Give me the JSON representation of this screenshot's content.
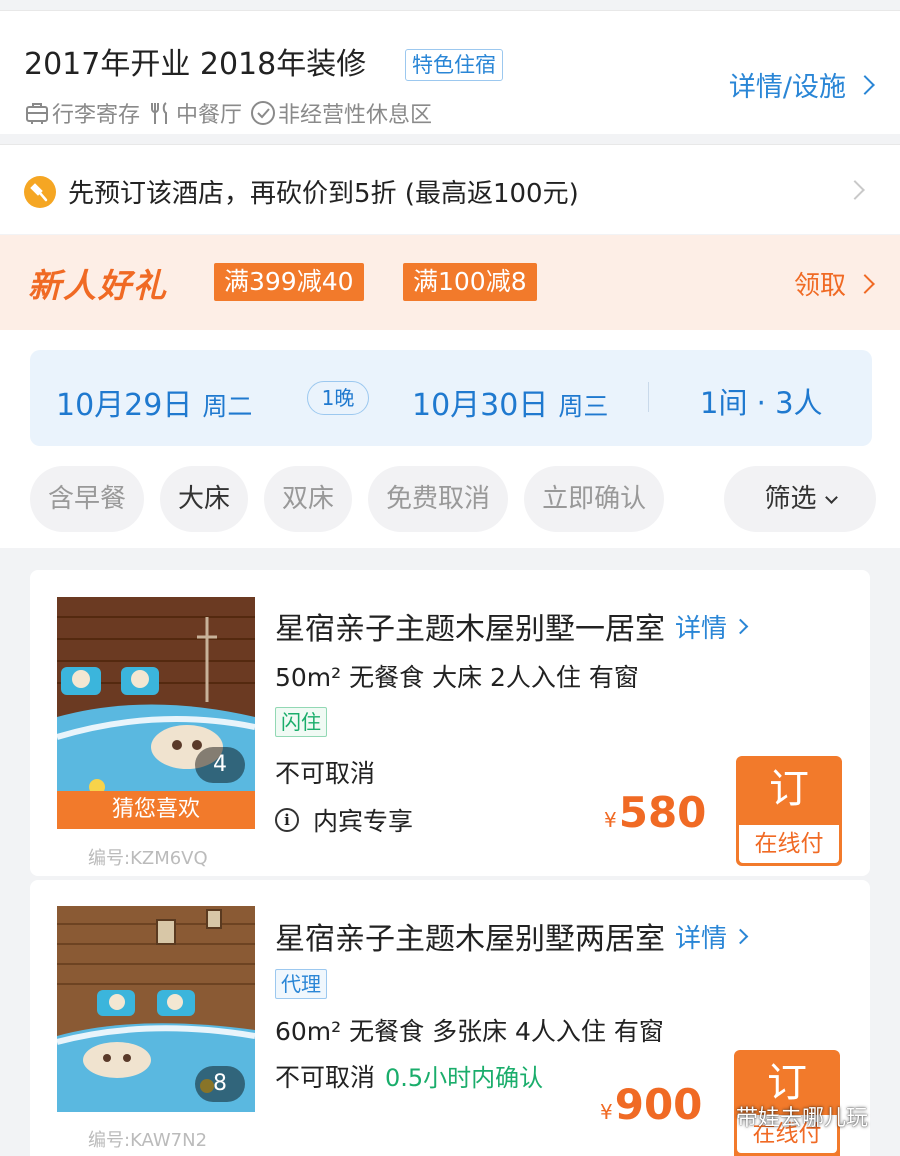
{
  "hotel_info": {
    "title": "2017年开业 2018年装修",
    "feature_tag": "特色住宿",
    "facilities": [
      {
        "icon": "luggage-icon",
        "label": "行李寄存"
      },
      {
        "icon": "restaurant-icon",
        "label": "中餐厅"
      },
      {
        "icon": "check-circle-icon",
        "label": "非经营性休息区"
      }
    ],
    "detail_link": "详情/设施"
  },
  "bargain": {
    "icon": "bargain-hammer-icon",
    "text": "先预订该酒店，再砍价到5折 (最高返100元)"
  },
  "new_user_gift": {
    "logo": "新人好礼",
    "coupons": [
      "满399减40",
      "满100减8"
    ],
    "claim": "领取"
  },
  "stay": {
    "checkin_date": "10月29日",
    "checkin_weekday": "周二",
    "nights": "1晚",
    "checkout_date": "10月30日",
    "checkout_weekday": "周三",
    "rooms_guests": "1间 · 3人"
  },
  "filters": {
    "chips": [
      "含早餐",
      "大床",
      "双床",
      "免费取消",
      "立即确认"
    ],
    "active_chip": "大床",
    "filter_button": "筛选"
  },
  "rooms": [
    {
      "name": "星宿亲子主题木屋别墅一居室",
      "detail": "详情",
      "spec": "50m² 无餐食 大床 2人入住 有窗",
      "badge": "闪住",
      "policy": "不可取消",
      "exclusive": "内宾专享",
      "photo_count": "4",
      "guess_label": "猜您喜欢",
      "code": "编号:KZM6VQ",
      "currency": "¥",
      "price": "580",
      "book_label": "订",
      "pay_label": "在线付"
    },
    {
      "name": "星宿亲子主题木屋别墅两居室",
      "detail": "详情",
      "badge": "代理",
      "spec": "60m² 无餐食 多张床 4人入住 有窗",
      "policy": "不可取消",
      "confirm": "0.5小时内确认",
      "photo_count": "8",
      "code": "编号:KAW7N2",
      "currency": "¥",
      "price": "900",
      "book_label": "订",
      "pay_label": "在线付"
    }
  ],
  "watermark": "带娃去哪儿玩",
  "colors": {
    "primary_blue": "#2a86d6",
    "accent_orange": "#f27a2b",
    "price_orange": "#f06a24",
    "success_green": "#1aad6b"
  }
}
